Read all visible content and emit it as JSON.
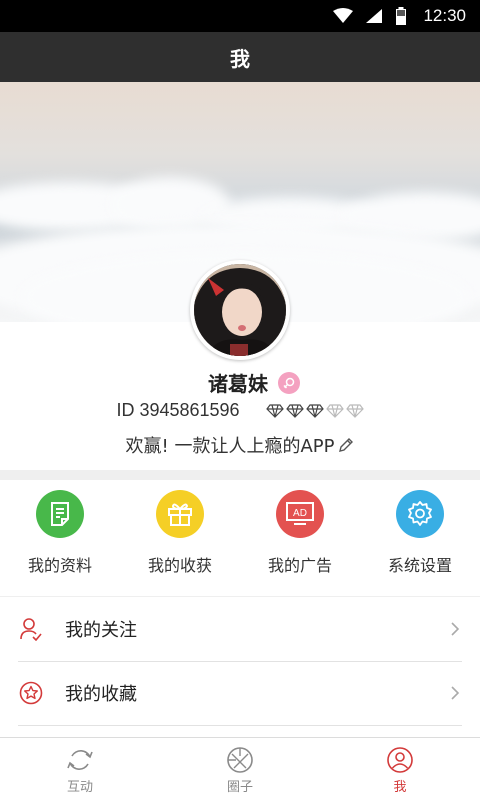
{
  "status_bar": {
    "time": "12:30"
  },
  "header": {
    "title": "我"
  },
  "profile": {
    "name": "诸葛妹",
    "id_text": "ID 3945861596",
    "motto": "欢赢! 一款让人上瘾的APP",
    "level_filled": 3,
    "level_total": 5
  },
  "quick_actions": [
    {
      "label": "我的资料",
      "icon": "document-icon",
      "color": "#48b84a"
    },
    {
      "label": "我的收获",
      "icon": "gift-icon",
      "color": "#f5cf26"
    },
    {
      "label": "我的广告",
      "icon": "ad-icon",
      "color": "#e35250"
    },
    {
      "label": "系统设置",
      "icon": "gear-icon",
      "color": "#39aee4"
    }
  ],
  "menu": [
    {
      "label": "我的关注",
      "icon": "user-follow-icon"
    },
    {
      "label": "我的收藏",
      "icon": "star-circle-icon"
    }
  ],
  "tabs": [
    {
      "label": "互动",
      "icon": "refresh-icon"
    },
    {
      "label": "圈子",
      "icon": "aperture-icon"
    },
    {
      "label": "我",
      "icon": "profile-icon",
      "active": true
    }
  ],
  "colors": {
    "accent": "#d33a3a",
    "title_bar": "#2f2f2f"
  }
}
